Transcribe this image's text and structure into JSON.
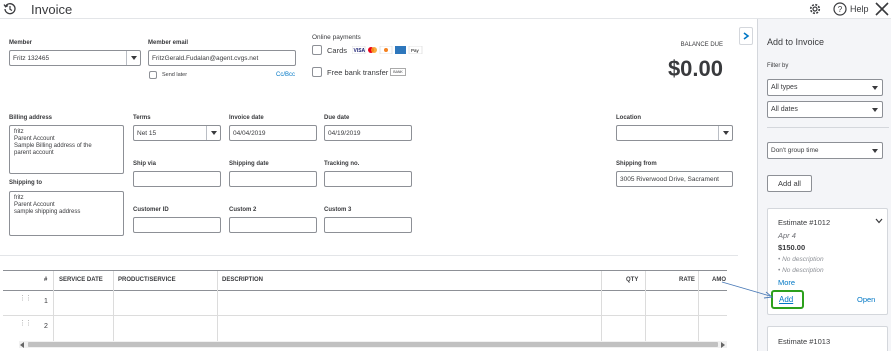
{
  "header": {
    "title": "Invoice",
    "help_label": "Help"
  },
  "customer": {
    "label": "Member",
    "value": "Fritz 132465"
  },
  "email": {
    "label": "Member email",
    "value": "FritzGerald.Fudalan@agent.cvgs.net",
    "send_later": "Send later",
    "cc_bcc": "Cc/Bcc"
  },
  "online_payments": {
    "label": "Online payments",
    "cards": "Cards",
    "bank": "Free bank transfer",
    "bank_badge": "BANK"
  },
  "balance": {
    "label": "BALANCE DUE",
    "amount": "$0.00"
  },
  "billing": {
    "label": "Billing address",
    "value": "fritz\nParent Account\nSample Billing address of the\nparent account"
  },
  "shipping_to": {
    "label": "Shipping to",
    "value": "fritz\nParent Account\nsample shipping address"
  },
  "terms": {
    "label": "Terms",
    "value": "Net 15"
  },
  "invoice_date": {
    "label": "Invoice date",
    "value": "04/04/2019"
  },
  "due_date": {
    "label": "Due date",
    "value": "04/19/2019"
  },
  "location": {
    "label": "Location",
    "value": ""
  },
  "ship_via": {
    "label": "Ship via",
    "value": ""
  },
  "shipping_date": {
    "label": "Shipping date",
    "value": ""
  },
  "tracking": {
    "label": "Tracking no.",
    "value": ""
  },
  "shipping_from": {
    "label": "Shipping from",
    "value": "3005 Riverwood Drive, Sacrament"
  },
  "customer_id": {
    "label": "Customer ID",
    "value": ""
  },
  "custom2": {
    "label": "Custom 2",
    "value": ""
  },
  "custom3": {
    "label": "Custom 3",
    "value": ""
  },
  "table": {
    "columns": [
      "#",
      "SERVICE DATE",
      "PRODUCT/SERVICE",
      "DESCRIPTION",
      "QTY",
      "RATE",
      "AMO"
    ],
    "rows": [
      "1",
      "2"
    ]
  },
  "panel": {
    "title": "Add to Invoice",
    "filter_label": "Filter by",
    "type_filter": "All types",
    "date_filter": "All dates",
    "group_filter": "Don't group time",
    "add_all": "Add all",
    "cards": [
      {
        "title": "Estimate #1012",
        "date": "Apr 4",
        "amount": "$150.00",
        "lines": [
          "No description",
          "No description"
        ],
        "more": "More",
        "add": "Add",
        "open": "Open"
      },
      {
        "title": "Estimate #1013"
      }
    ]
  },
  "colors": {
    "accent": "#0077c5",
    "highlight": "#2ca01c",
    "panel_bg": "#f4f5f8"
  }
}
